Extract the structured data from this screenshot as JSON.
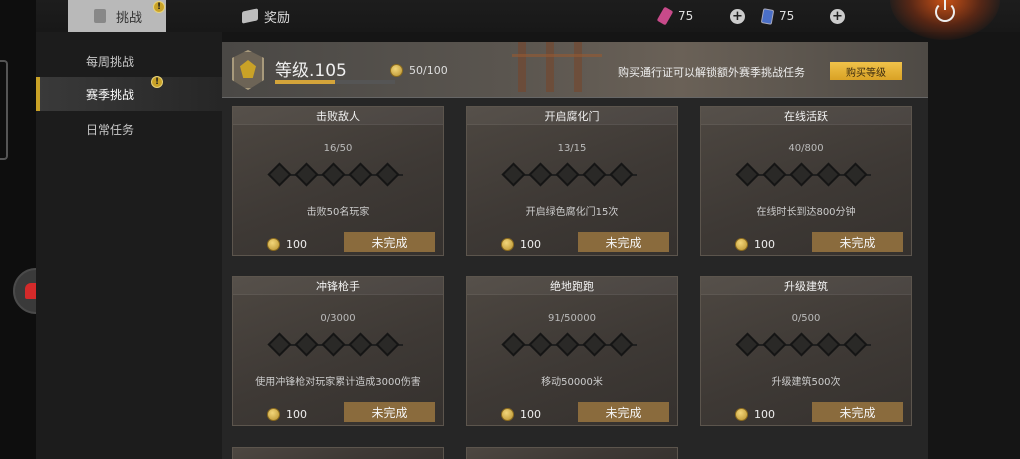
{
  "topbar": {
    "tab_challenge": "挑战",
    "tab_reward": "奖励",
    "currency1": "75",
    "currency2": "75",
    "plus": "+",
    "alert": "!"
  },
  "sidebar": {
    "items": [
      {
        "label": "每周挑战"
      },
      {
        "label": "赛季挑战"
      },
      {
        "label": "日常任务"
      }
    ]
  },
  "banner": {
    "level": "等级.105",
    "xp": "50/100",
    "xp_progress": 0.5,
    "message": "购买通行证可以解锁额外赛季挑战任务",
    "buy_label": "购买等级"
  },
  "cards": [
    {
      "title": "击败敌人",
      "progress": "16/50",
      "desc": "击败50名玩家",
      "reward": "100",
      "status": "未完成"
    },
    {
      "title": "开启腐化门",
      "progress": "13/15",
      "desc": "开启绿色腐化门15次",
      "reward": "100",
      "status": "未完成"
    },
    {
      "title": "在线活跃",
      "progress": "40/800",
      "desc": "在线时长到达800分钟",
      "reward": "100",
      "status": "未完成"
    },
    {
      "title": "冲锋枪手",
      "progress": "0/3000",
      "desc": "使用冲锋枪对玩家累计造成3000伤害",
      "reward": "100",
      "status": "未完成"
    },
    {
      "title": "绝地跑跑",
      "progress": "91/50000",
      "desc": "移动50000米",
      "reward": "100",
      "status": "未完成"
    },
    {
      "title": "升级建筑",
      "progress": "0/500",
      "desc": "升级建筑500次",
      "reward": "100",
      "status": "未完成"
    }
  ],
  "colors": {
    "accent": "#c9a227",
    "status_button": "#8a6b3d",
    "buy_button": "#e8b43a"
  }
}
